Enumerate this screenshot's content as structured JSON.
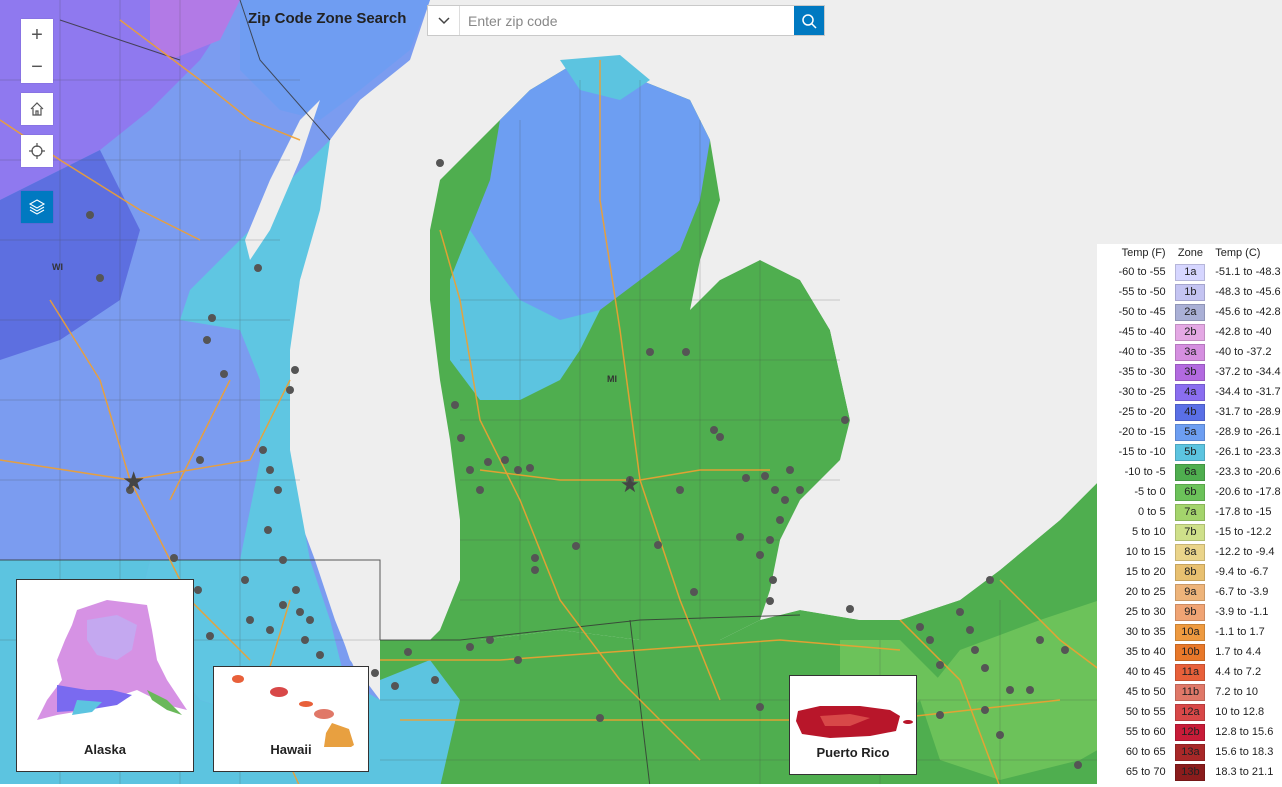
{
  "search": {
    "title": "Zip Code Zone Search",
    "placeholder": "Enter zip code",
    "value": ""
  },
  "map_labels": {
    "wisconsin": "WI",
    "michigan": "MI"
  },
  "insets": {
    "alaska": "Alaska",
    "hawaii": "Hawaii",
    "puerto_rico": "Puerto Rico"
  },
  "legend": {
    "headers": {
      "temp_f": "Temp (F)",
      "zone": "Zone",
      "temp_c": "Temp (C)"
    },
    "rows": [
      {
        "f": "-60 to -55",
        "zone": "1a",
        "c": "-51.1 to -48.3",
        "color": "#d6d6ff"
      },
      {
        "f": "-55 to -50",
        "zone": "1b",
        "c": "-48.3 to -45.6",
        "color": "#c4c4f2"
      },
      {
        "f": "-50 to -45",
        "zone": "2a",
        "c": "-45.6 to -42.8",
        "color": "#aab0d6"
      },
      {
        "f": "-45 to -40",
        "zone": "2b",
        "c": "-42.8 to -40",
        "color": "#e4a8e4"
      },
      {
        "f": "-40 to -35",
        "zone": "3a",
        "c": "-40 to -37.2",
        "color": "#d58fe0"
      },
      {
        "f": "-35 to -30",
        "zone": "3b",
        "c": "-37.2 to -34.4",
        "color": "#b36ae0"
      },
      {
        "f": "-30 to -25",
        "zone": "4a",
        "c": "-34.4 to -31.7",
        "color": "#8a6ef0"
      },
      {
        "f": "-25 to -20",
        "zone": "4b",
        "c": "-31.7 to -28.9",
        "color": "#5a6fe6"
      },
      {
        "f": "-20 to -15",
        "zone": "5a",
        "c": "-28.9 to -26.1",
        "color": "#6d9ef2"
      },
      {
        "f": "-15 to -10",
        "zone": "5b",
        "c": "-26.1 to -23.3",
        "color": "#5cc4e0"
      },
      {
        "f": "-10 to -5",
        "zone": "6a",
        "c": "-23.3 to -20.6",
        "color": "#4fae4f"
      },
      {
        "f": "-5 to 0",
        "zone": "6b",
        "c": "-20.6 to -17.8",
        "color": "#6cc25a"
      },
      {
        "f": "0 to 5",
        "zone": "7a",
        "c": "-17.8 to -15",
        "color": "#a4d46c"
      },
      {
        "f": "5 to 10",
        "zone": "7b",
        "c": "-15 to -12.2",
        "color": "#cfe08a"
      },
      {
        "f": "10 to 15",
        "zone": "8a",
        "c": "-12.2 to -9.4",
        "color": "#ead48a"
      },
      {
        "f": "15 to 20",
        "zone": "8b",
        "c": "-9.4 to -6.7",
        "color": "#e8c070"
      },
      {
        "f": "20 to 25",
        "zone": "9a",
        "c": "-6.7 to -3.9",
        "color": "#eeb47a"
      },
      {
        "f": "25 to 30",
        "zone": "9b",
        "c": "-3.9 to -1.1",
        "color": "#f0a474"
      },
      {
        "f": "30 to 35",
        "zone": "10a",
        "c": "-1.1 to 1.7",
        "color": "#ee9a40"
      },
      {
        "f": "35 to 40",
        "zone": "10b",
        "c": "1.7 to 4.4",
        "color": "#e8782a"
      },
      {
        "f": "40 to 45",
        "zone": "11a",
        "c": "4.4 to 7.2",
        "color": "#e8603a"
      },
      {
        "f": "45 to 50",
        "zone": "11b",
        "c": "7.2 to 10",
        "color": "#e07868"
      },
      {
        "f": "50 to 55",
        "zone": "12a",
        "c": "10 to 12.8",
        "color": "#d84848"
      },
      {
        "f": "55 to 60",
        "zone": "12b",
        "c": "12.8 to 15.6",
        "color": "#c81c38"
      },
      {
        "f": "60 to 65",
        "zone": "13a",
        "c": "15.6 to 18.3",
        "color": "#a82828"
      },
      {
        "f": "65 to 70",
        "zone": "13b",
        "c": "18.3 to 21.1",
        "color": "#8a1c1c"
      }
    ]
  }
}
